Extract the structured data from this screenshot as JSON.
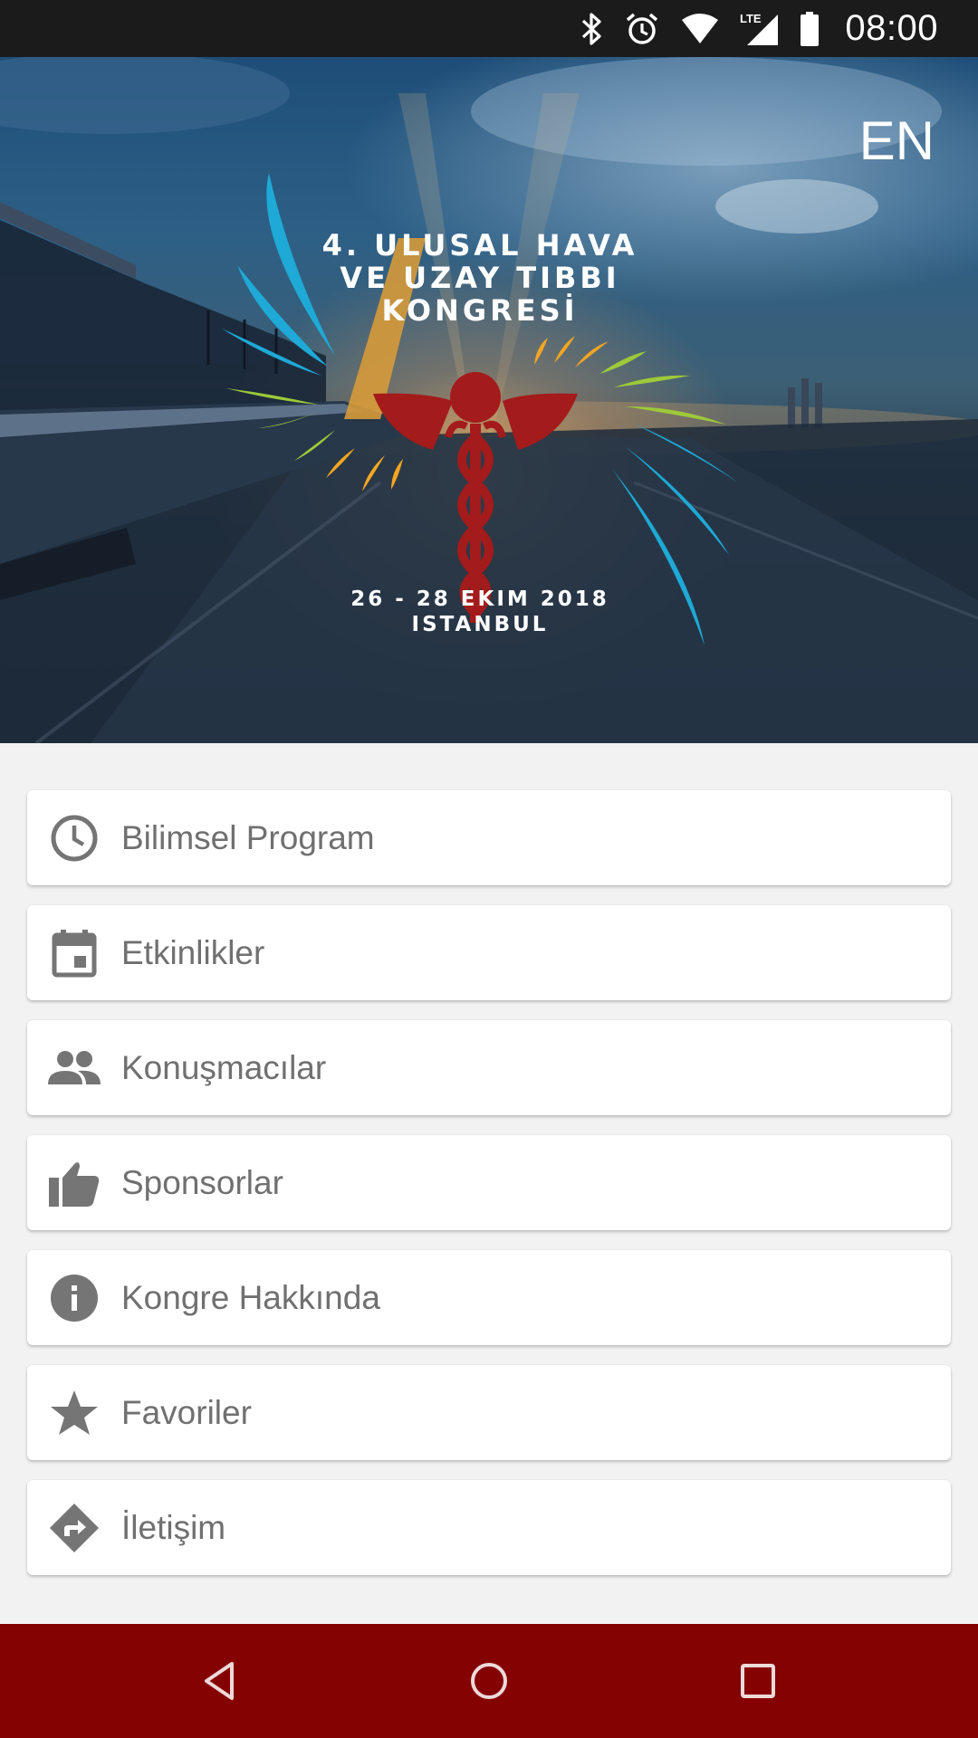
{
  "status_bar": {
    "time": "08:00",
    "icons": [
      "bluetooth-icon",
      "alarm-icon",
      "wifi-icon",
      "lte-signal-icon",
      "battery-icon"
    ],
    "lte_label": "LTE"
  },
  "hero": {
    "language_toggle": "EN",
    "title_line1": "4. ULUSAL HAVA",
    "title_line2": "VE UZAY TIBBI",
    "title_line3": "KONGRESİ",
    "date": "26 - 28 EKIM 2018",
    "city": "ISTANBUL",
    "logo": "caduceus-logo"
  },
  "menu": {
    "items": [
      {
        "label": "Bilimsel Program",
        "icon": "clock-icon"
      },
      {
        "label": "Etkinlikler",
        "icon": "calendar-icon"
      },
      {
        "label": "Konuşmacılar",
        "icon": "people-icon"
      },
      {
        "label": "Sponsorlar",
        "icon": "thumb-up-icon"
      },
      {
        "label": "Kongre Hakkında",
        "icon": "info-icon"
      },
      {
        "label": "Favoriler",
        "icon": "star-icon"
      },
      {
        "label": "İletişim",
        "icon": "directions-icon"
      }
    ]
  },
  "nav_bar": {
    "buttons": [
      "back-icon",
      "home-icon",
      "recents-icon"
    ]
  },
  "colors": {
    "nav_bar": "#850202",
    "status_bar": "#1b1b1b",
    "menu_text": "#707070",
    "menu_icon": "#757575",
    "background": "#f2f2f2",
    "logo_red": "#a31b1b",
    "logo_blue": "#1ea9d6",
    "logo_green": "#9dc93a",
    "logo_orange": "#f5a623"
  }
}
